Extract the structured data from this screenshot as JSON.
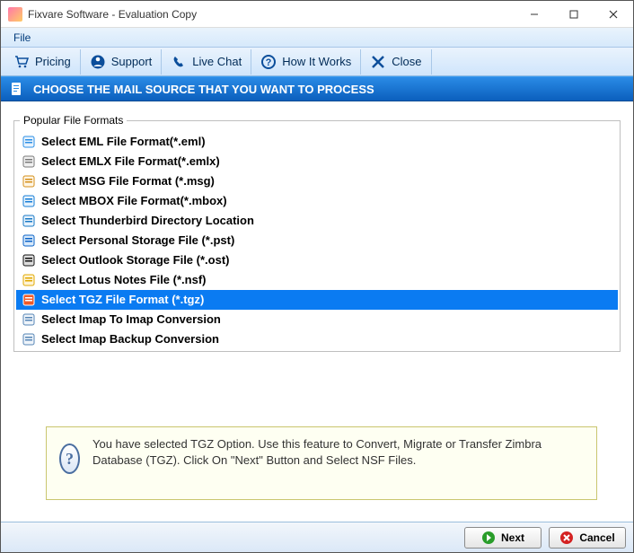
{
  "window": {
    "title": "Fixvare Software - Evaluation Copy"
  },
  "menu": {
    "file": "File"
  },
  "toolbar": {
    "pricing": "Pricing",
    "support": "Support",
    "livechat": "Live Chat",
    "howitworks": "How It Works",
    "close": "Close"
  },
  "section": {
    "title": "CHOOSE THE MAIL SOURCE THAT YOU WANT TO PROCESS"
  },
  "formats": {
    "legend": "Popular File Formats",
    "items": [
      {
        "label": "Select EML File Format(*.eml)",
        "iconColor": "#2b8fe6",
        "iconBg": "#e8f3fd"
      },
      {
        "label": "Select EMLX File Format(*.emlx)",
        "iconColor": "#7a7a7a",
        "iconBg": "#f0f0f0"
      },
      {
        "label": "Select MSG File Format (*.msg)",
        "iconColor": "#d48f1a",
        "iconBg": "#fff6e6"
      },
      {
        "label": "Select MBOX File Format(*.mbox)",
        "iconColor": "#167dd6",
        "iconBg": "#e6f2fd"
      },
      {
        "label": "Select Thunderbird Directory Location",
        "iconColor": "#1979c5",
        "iconBg": "#e6f2fd"
      },
      {
        "label": "Select Personal Storage File (*.pst)",
        "iconColor": "#0b63c7",
        "iconBg": "#d7e9fb"
      },
      {
        "label": "Select Outlook Storage File (*.ost)",
        "iconColor": "#111",
        "iconBg": "#ddd"
      },
      {
        "label": "Select Lotus Notes File (*.nsf)",
        "iconColor": "#e0a800",
        "iconBg": "#fff4d6"
      },
      {
        "label": "Select TGZ File Format (*.tgz)",
        "iconColor": "#fff",
        "iconBg": "#f05a28",
        "selected": true
      },
      {
        "label": "Select Imap To Imap Conversion",
        "iconColor": "#5585b5",
        "iconBg": "#eef4fa"
      },
      {
        "label": "Select Imap Backup Conversion",
        "iconColor": "#5585b5",
        "iconBg": "#eef4fa"
      }
    ]
  },
  "info": {
    "text": "You have selected TGZ Option. Use this feature to Convert, Migrate or Transfer Zimbra Database (TGZ). Click On \"Next\" Button and Select NSF Files."
  },
  "footer": {
    "next": "Next",
    "cancel": "Cancel"
  }
}
